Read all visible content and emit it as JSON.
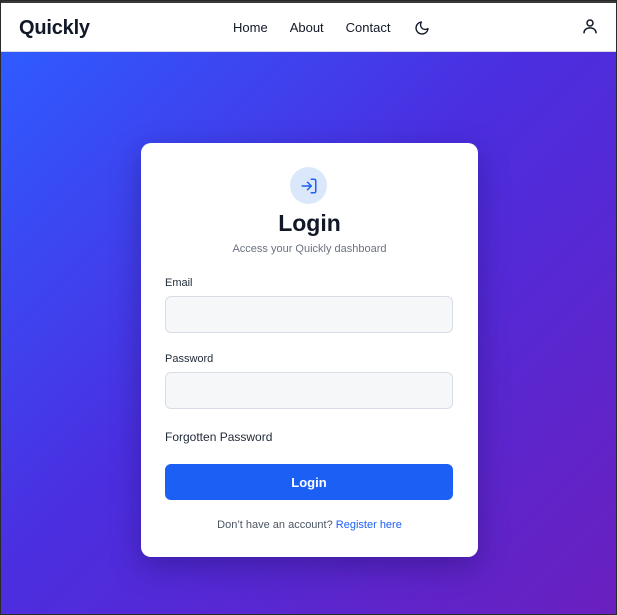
{
  "navbar": {
    "brand": "Quickly",
    "links": [
      {
        "label": "Home"
      },
      {
        "label": "About"
      },
      {
        "label": "Contact"
      }
    ],
    "theme_icon": "moon-icon",
    "user_icon": "user-icon"
  },
  "login_card": {
    "icon": "login-icon",
    "title": "Login",
    "subtitle": "Access your Quickly dashboard",
    "email": {
      "label": "Email",
      "value": "",
      "placeholder": ""
    },
    "password": {
      "label": "Password",
      "value": "",
      "placeholder": ""
    },
    "forgot_label": "Forgotten Password",
    "submit_label": "Login",
    "register_prompt": "Don’t have an account?",
    "register_link": "Register here"
  },
  "colors": {
    "accent": "#1c5ff5",
    "gradient_start": "#2f5bff",
    "gradient_end": "#6a1fbe",
    "icon_bg": "#dbe7fb"
  }
}
